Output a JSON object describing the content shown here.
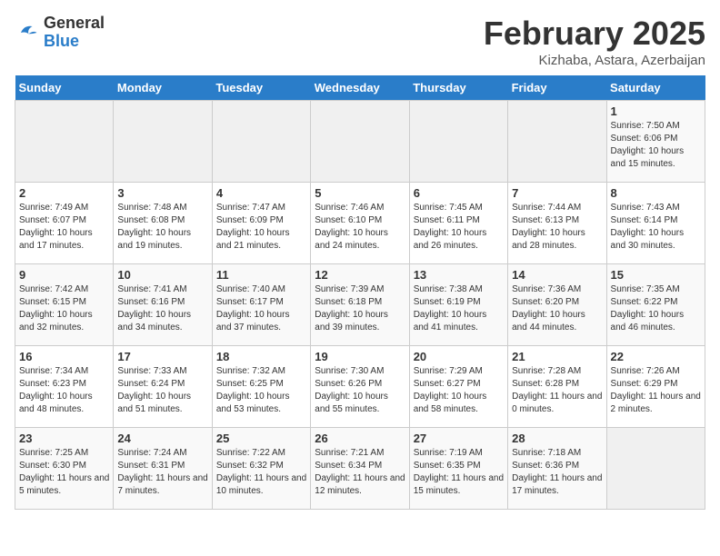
{
  "logo": {
    "general": "General",
    "blue": "Blue"
  },
  "title": "February 2025",
  "subtitle": "Kizhaba, Astara, Azerbaijan",
  "days_of_week": [
    "Sunday",
    "Monday",
    "Tuesday",
    "Wednesday",
    "Thursday",
    "Friday",
    "Saturday"
  ],
  "weeks": [
    [
      {
        "day": "",
        "info": ""
      },
      {
        "day": "",
        "info": ""
      },
      {
        "day": "",
        "info": ""
      },
      {
        "day": "",
        "info": ""
      },
      {
        "day": "",
        "info": ""
      },
      {
        "day": "",
        "info": ""
      },
      {
        "day": "1",
        "info": "Sunrise: 7:50 AM\nSunset: 6:06 PM\nDaylight: 10 hours\nand 15 minutes."
      }
    ],
    [
      {
        "day": "2",
        "info": "Sunrise: 7:49 AM\nSunset: 6:07 PM\nDaylight: 10 hours\nand 17 minutes."
      },
      {
        "day": "3",
        "info": "Sunrise: 7:48 AM\nSunset: 6:08 PM\nDaylight: 10 hours\nand 19 minutes."
      },
      {
        "day": "4",
        "info": "Sunrise: 7:47 AM\nSunset: 6:09 PM\nDaylight: 10 hours\nand 21 minutes."
      },
      {
        "day": "5",
        "info": "Sunrise: 7:46 AM\nSunset: 6:10 PM\nDaylight: 10 hours\nand 24 minutes."
      },
      {
        "day": "6",
        "info": "Sunrise: 7:45 AM\nSunset: 6:11 PM\nDaylight: 10 hours\nand 26 minutes."
      },
      {
        "day": "7",
        "info": "Sunrise: 7:44 AM\nSunset: 6:13 PM\nDaylight: 10 hours\nand 28 minutes."
      },
      {
        "day": "8",
        "info": "Sunrise: 7:43 AM\nSunset: 6:14 PM\nDaylight: 10 hours\nand 30 minutes."
      }
    ],
    [
      {
        "day": "9",
        "info": "Sunrise: 7:42 AM\nSunset: 6:15 PM\nDaylight: 10 hours\nand 32 minutes."
      },
      {
        "day": "10",
        "info": "Sunrise: 7:41 AM\nSunset: 6:16 PM\nDaylight: 10 hours\nand 34 minutes."
      },
      {
        "day": "11",
        "info": "Sunrise: 7:40 AM\nSunset: 6:17 PM\nDaylight: 10 hours\nand 37 minutes."
      },
      {
        "day": "12",
        "info": "Sunrise: 7:39 AM\nSunset: 6:18 PM\nDaylight: 10 hours\nand 39 minutes."
      },
      {
        "day": "13",
        "info": "Sunrise: 7:38 AM\nSunset: 6:19 PM\nDaylight: 10 hours\nand 41 minutes."
      },
      {
        "day": "14",
        "info": "Sunrise: 7:36 AM\nSunset: 6:20 PM\nDaylight: 10 hours\nand 44 minutes."
      },
      {
        "day": "15",
        "info": "Sunrise: 7:35 AM\nSunset: 6:22 PM\nDaylight: 10 hours\nand 46 minutes."
      }
    ],
    [
      {
        "day": "16",
        "info": "Sunrise: 7:34 AM\nSunset: 6:23 PM\nDaylight: 10 hours\nand 48 minutes."
      },
      {
        "day": "17",
        "info": "Sunrise: 7:33 AM\nSunset: 6:24 PM\nDaylight: 10 hours\nand 51 minutes."
      },
      {
        "day": "18",
        "info": "Sunrise: 7:32 AM\nSunset: 6:25 PM\nDaylight: 10 hours\nand 53 minutes."
      },
      {
        "day": "19",
        "info": "Sunrise: 7:30 AM\nSunset: 6:26 PM\nDaylight: 10 hours\nand 55 minutes."
      },
      {
        "day": "20",
        "info": "Sunrise: 7:29 AM\nSunset: 6:27 PM\nDaylight: 10 hours\nand 58 minutes."
      },
      {
        "day": "21",
        "info": "Sunrise: 7:28 AM\nSunset: 6:28 PM\nDaylight: 11 hours\nand 0 minutes."
      },
      {
        "day": "22",
        "info": "Sunrise: 7:26 AM\nSunset: 6:29 PM\nDaylight: 11 hours\nand 2 minutes."
      }
    ],
    [
      {
        "day": "23",
        "info": "Sunrise: 7:25 AM\nSunset: 6:30 PM\nDaylight: 11 hours\nand 5 minutes."
      },
      {
        "day": "24",
        "info": "Sunrise: 7:24 AM\nSunset: 6:31 PM\nDaylight: 11 hours\nand 7 minutes."
      },
      {
        "day": "25",
        "info": "Sunrise: 7:22 AM\nSunset: 6:32 PM\nDaylight: 11 hours\nand 10 minutes."
      },
      {
        "day": "26",
        "info": "Sunrise: 7:21 AM\nSunset: 6:34 PM\nDaylight: 11 hours\nand 12 minutes."
      },
      {
        "day": "27",
        "info": "Sunrise: 7:19 AM\nSunset: 6:35 PM\nDaylight: 11 hours\nand 15 minutes."
      },
      {
        "day": "28",
        "info": "Sunrise: 7:18 AM\nSunset: 6:36 PM\nDaylight: 11 hours\nand 17 minutes."
      },
      {
        "day": "",
        "info": ""
      }
    ]
  ]
}
